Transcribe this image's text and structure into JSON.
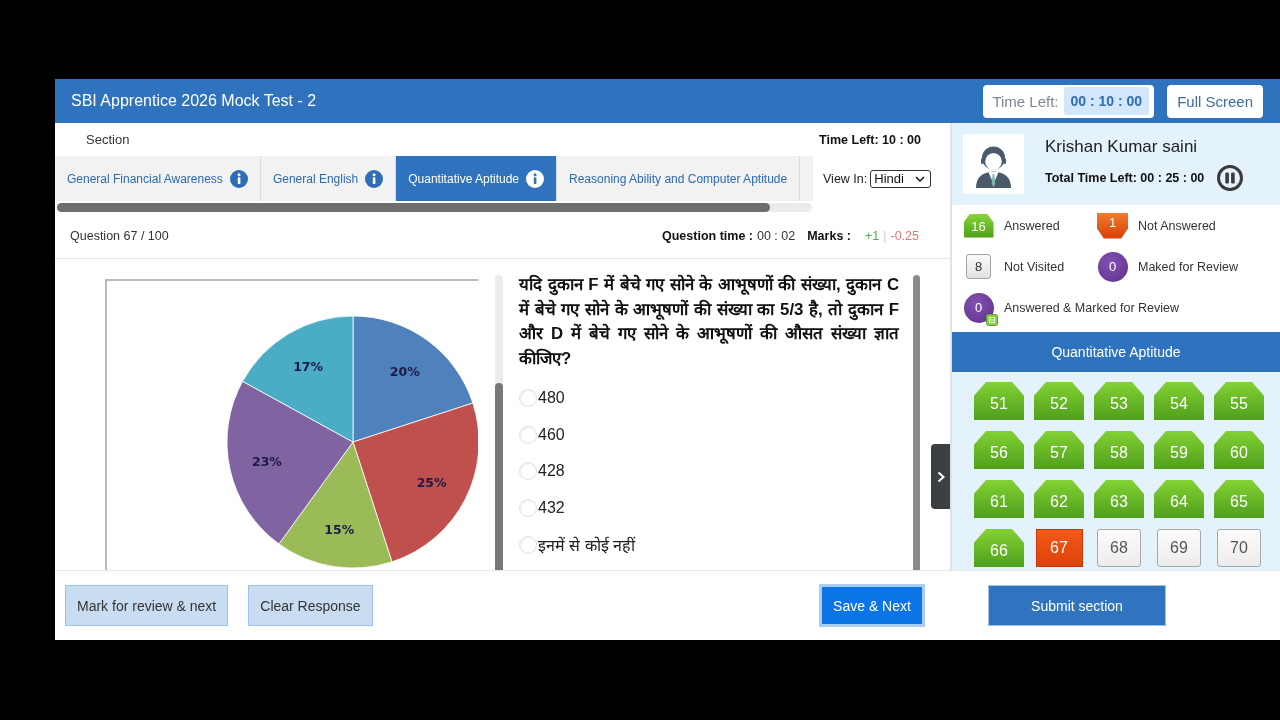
{
  "header": {
    "title": "SBI Apprentice 2026 Mock Test - 2",
    "time_left_label": "Time Left:",
    "time_left_value": "00 : 10 : 00",
    "full_screen_button": "Full Screen"
  },
  "section_bar": {
    "label": "Section",
    "time_left": "Time Left: 10 : 00"
  },
  "tabs": [
    {
      "label": "General Financial Awareness",
      "selected": false,
      "info_icon": true
    },
    {
      "label": "General English",
      "selected": false,
      "info_icon": true
    },
    {
      "label": "Quantitative Aptitude",
      "selected": true,
      "info_icon": true
    },
    {
      "label": "Reasoning Ability and Computer Aptitude",
      "selected": false,
      "info_icon": false
    }
  ],
  "view_in": {
    "label": "View In:",
    "value": "Hindi"
  },
  "question_info": {
    "number": "Question 67 / 100",
    "time_label": "Question time :",
    "time_value": "00 : 02",
    "marks_label": "Marks :",
    "positive_marks": "+1",
    "separator": "|",
    "negative_marks": "-0.25"
  },
  "figure": {
    "chart_data": {
      "type": "pie",
      "values": [
        20,
        25,
        15,
        23,
        17
      ],
      "value_labels": [
        "20%",
        "25%",
        "15%",
        "23%",
        "17%"
      ]
    }
  },
  "question": {
    "text": "यदि दुकान F में बेचे गए सोने के आभूषणों की संख्या, दुकान C में बेचे गए सोने के आभूषणों की संख्या का 5/3 है, तो दुकान F और D में बेचे गए सोने के आभूषणों की औसत संख्या ज्ञात कीजिए?",
    "options": [
      {
        "label": "480",
        "selected": false
      },
      {
        "label": "460",
        "selected": false
      },
      {
        "label": "428",
        "selected": false
      },
      {
        "label": "432",
        "selected": false
      },
      {
        "label": "इनमें से कोई नहीं",
        "selected": false
      }
    ]
  },
  "profile": {
    "name": "Krishan Kumar saini",
    "total_time": "Total Time Left: 00 : 25 : 00"
  },
  "legend": [
    {
      "kind": "answered",
      "count": "16",
      "label": "Answered"
    },
    {
      "kind": "not_answered",
      "count": "1",
      "label": "Not Answered"
    },
    {
      "kind": "not_visited",
      "count": "8",
      "label": "Not Visited"
    },
    {
      "kind": "marked",
      "count": "0",
      "label": "Maked for Review"
    },
    {
      "kind": "answered_marked",
      "count": "0",
      "label": "Answered & Marked for Review"
    }
  ],
  "palette": {
    "section": "Quantitative Aptitude",
    "questions": [
      {
        "number": "51",
        "kind": "answered"
      },
      {
        "number": "52",
        "kind": "answered"
      },
      {
        "number": "53",
        "kind": "answered"
      },
      {
        "number": "54",
        "kind": "answered"
      },
      {
        "number": "55",
        "kind": "answered"
      },
      {
        "number": "56",
        "kind": "answered"
      },
      {
        "number": "57",
        "kind": "answered"
      },
      {
        "number": "58",
        "kind": "answered"
      },
      {
        "number": "59",
        "kind": "answered"
      },
      {
        "number": "60",
        "kind": "answered"
      },
      {
        "number": "61",
        "kind": "answered"
      },
      {
        "number": "62",
        "kind": "answered"
      },
      {
        "number": "63",
        "kind": "answered"
      },
      {
        "number": "64",
        "kind": "answered"
      },
      {
        "number": "65",
        "kind": "answered"
      },
      {
        "number": "66",
        "kind": "answered"
      },
      {
        "number": "67",
        "kind": "not_answered"
      },
      {
        "number": "68",
        "kind": "not_visited"
      },
      {
        "number": "69",
        "kind": "not_visited"
      },
      {
        "number": "70",
        "kind": "not_visited"
      }
    ]
  },
  "actions": {
    "mark_review": "Mark for review & next",
    "clear_response": "Clear Response",
    "save_next": "Save & Next",
    "submit_section": "Submit section"
  }
}
